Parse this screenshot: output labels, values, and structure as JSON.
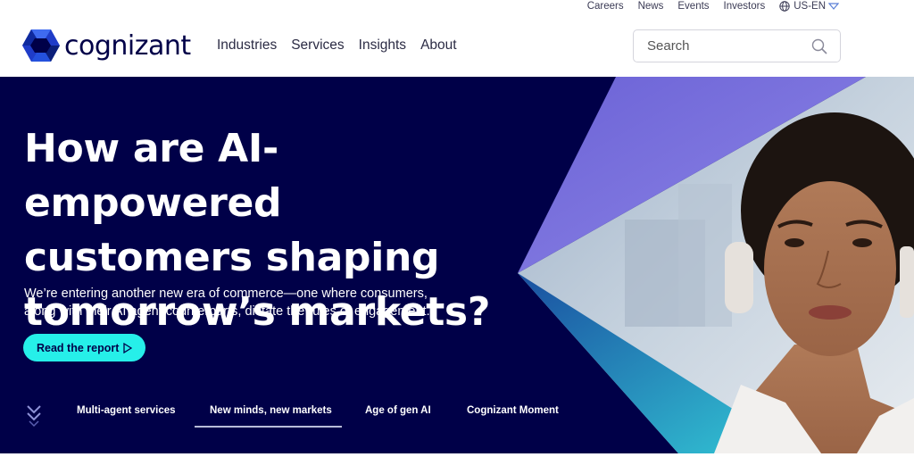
{
  "utility_nav": {
    "careers": "Careers",
    "news": "News",
    "events": "Events",
    "investors": "Investors",
    "language": "US-EN"
  },
  "brand": {
    "name": "cognizant"
  },
  "main_nav": {
    "industries": "Industries",
    "services": "Services",
    "insights": "Insights",
    "about": "About"
  },
  "search": {
    "placeholder": "Search"
  },
  "hero": {
    "headline_line1": "How are AI-empowered",
    "headline_line2": "customers shaping",
    "headline_line3": "tomorrow’s markets?",
    "subtext_line1": "We’re entering another new era of commerce—one where consumers,",
    "subtext_line2": "along with their AI agent counterparts, dictate the rules of engagement.",
    "cta_label": "Read the report"
  },
  "hero_tabs": {
    "items": [
      {
        "label": "Multi-agent services"
      },
      {
        "label": "New minds, new markets"
      },
      {
        "label": "Age of gen AI"
      },
      {
        "label": "Cognizant Moment"
      }
    ],
    "active": "New minds, new markets"
  },
  "colors": {
    "navy": "#000048",
    "accent_cyan": "#26efe9",
    "purple": "#7373d8",
    "teal": "#2db8c8"
  }
}
